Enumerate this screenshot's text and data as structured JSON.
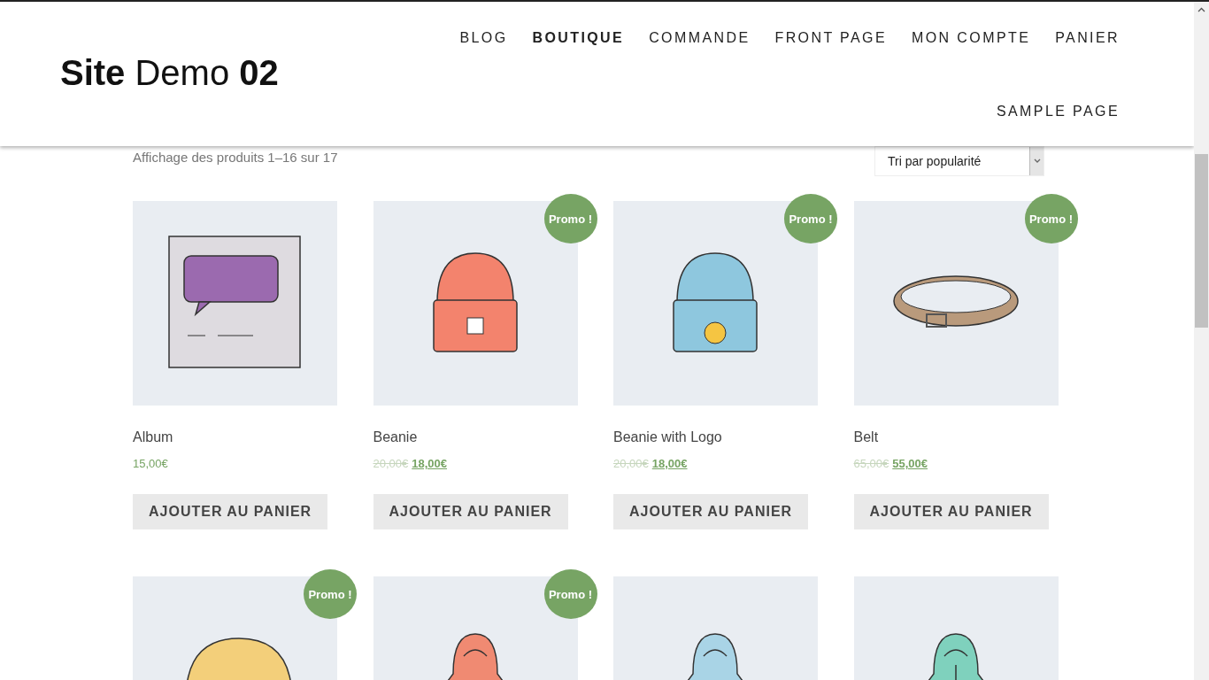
{
  "header": {
    "logo": "**Site** Demo **02**",
    "nav": [
      {
        "label": "BLOG",
        "selected": false
      },
      {
        "label": "BOUTIQUE",
        "selected": true
      },
      {
        "label": "COMMANDE",
        "selected": false
      },
      {
        "label": "FRONT PAGE",
        "selected": false
      },
      {
        "label": "MON COMPTE",
        "selected": false
      },
      {
        "label": "PANIER",
        "selected": false
      },
      {
        "label": "SAMPLE PAGE",
        "selected": false
      }
    ]
  },
  "shop": {
    "result_count": "Affichage des produits 1–16 sur 17",
    "sort": {
      "value": "Tri par popularité"
    },
    "products": [
      {
        "kind": "album",
        "name": "Album",
        "price": "15,00€",
        "button": "AJOUTER AU PANIER"
      },
      {
        "kind": "beanie",
        "name": "Beanie",
        "old_price": "20,00€",
        "price": "18,00€",
        "badge": "Promo !",
        "button": "AJOUTER AU PANIER"
      },
      {
        "kind": "beanie-logo",
        "name": "Beanie with Logo",
        "old_price": "20,00€",
        "price": "18,00€",
        "badge": "Promo !",
        "button": "AJOUTER AU PANIER"
      },
      {
        "kind": "belt",
        "name": "Belt",
        "old_price": "65,00€",
        "price": "55,00€",
        "badge": "Promo !",
        "button": "AJOUTER AU PANIER"
      },
      {
        "kind": "cap",
        "badge": "Promo !"
      },
      {
        "kind": "hoodie",
        "badge": "Promo !"
      },
      {
        "kind": "hoodie-logo"
      },
      {
        "kind": "hoodie-zip"
      }
    ]
  }
}
